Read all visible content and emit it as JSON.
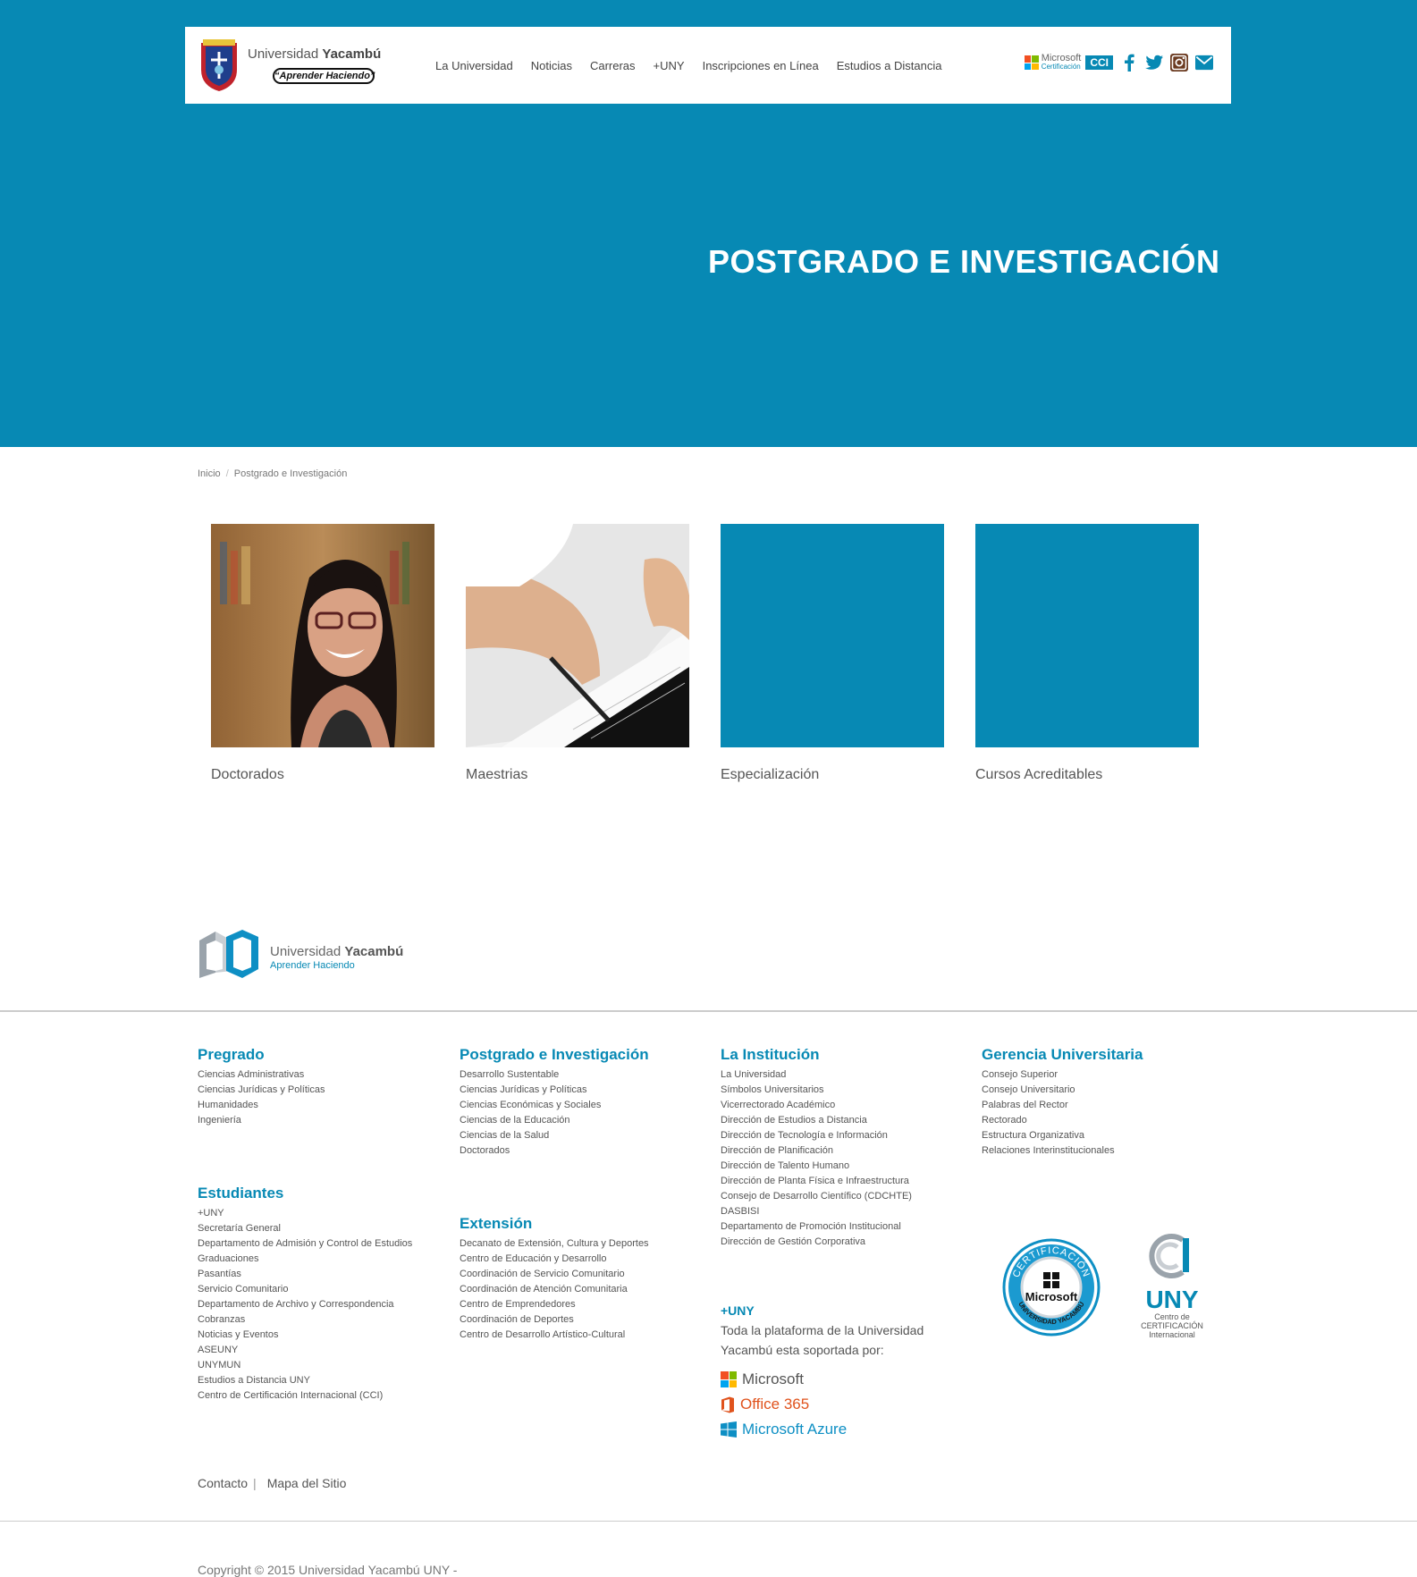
{
  "header": {
    "logo_name_regular": "Universidad",
    "logo_name_bold": "Yacambú",
    "logo_motto": "“Aprender Haciendo”",
    "nav": [
      "La Universidad",
      "Noticias",
      "Carreras",
      "+UNY",
      "Inscripciones en Línea",
      "Estudios a Distancia"
    ],
    "ms_badge_title": "Microsoft",
    "ms_badge_sub": "Certificación",
    "cci_label": "CCI"
  },
  "hero": {
    "title": "POSTGRADO E INVESTIGACIÓN",
    "bg_color": "#0789b4"
  },
  "breadcrumb": {
    "home": "Inicio",
    "current": "Postgrado e Investigación"
  },
  "cards": [
    {
      "label": "Doctorados",
      "image": "photo-woman-glasses"
    },
    {
      "label": "Maestrias",
      "image": "photo-hand-writing"
    },
    {
      "label": "Especialización",
      "image": "blue-placeholder"
    },
    {
      "label": "Cursos Acreditables",
      "image": "blue-placeholder"
    }
  ],
  "footer_logo": {
    "name_regular": "Universidad",
    "name_bold": "Yacambú",
    "motto": "Aprender Haciendo"
  },
  "footer_columns": {
    "pregrado": {
      "title": "Pregrado",
      "items": [
        "Ciencias Administrativas",
        "Ciencias Jurídicas y Políticas",
        "Humanidades",
        "Ingeniería"
      ]
    },
    "estudiantes": {
      "title": "Estudiantes",
      "items": [
        "+UNY",
        "Secretaría General",
        "Departamento de Admisión y Control de Estudios",
        "Graduaciones",
        "Pasantías",
        "Servicio Comunitario",
        "Departamento de Archivo y Correspondencia",
        "Cobranzas",
        "Noticias y Eventos",
        "ASEUNY",
        "UNYMUN",
        "Estudios a Distancia UNY",
        "Centro de Certificación Internacional (CCI)"
      ]
    },
    "postgrado": {
      "title": "Postgrado e Investigación",
      "items": [
        "Desarrollo Sustentable",
        "Ciencias Jurídicas y Políticas",
        "Ciencias Económicas y Sociales",
        "Ciencias de la Educación",
        "Ciencias de la Salud",
        "Doctorados"
      ]
    },
    "extension": {
      "title": "Extensión",
      "items": [
        "Decanato de Extensión, Cultura y Deportes",
        "Centro de Educación y Desarrollo",
        "Coordinación de Servicio Comunitario",
        "Coordinación de Atención Comunitaria",
        "Centro de Emprendedores",
        "Coordinación de Deportes",
        "Centro de Desarrollo Artístico-Cultural"
      ]
    },
    "institucion": {
      "title": "La Institución",
      "items": [
        "La Universidad",
        "Símbolos Universitarios",
        "Vicerrectorado Académico",
        "Dirección de Estudios a Distancia",
        "Dirección de Tecnología e Información",
        "Dirección de Planificación",
        "Dirección de Talento Humano",
        "Dirección de Planta Física e Infraestructura",
        "Consejo de Desarrollo Científico (CDCHTE)",
        "DASBISI",
        "Departamento de Promoción Institucional",
        "Dirección de Gestión Corporativa"
      ]
    },
    "gerencia": {
      "title": "Gerencia Universitaria",
      "items": [
        "Consejo Superior",
        "Consejo Universitario",
        "Palabras del Rector",
        "Rectorado",
        "Estructura Organizativa",
        "Relaciones Interinstitucionales"
      ]
    }
  },
  "platform": {
    "heading": "+UNY",
    "text": "Toda la plataforma de la Universidad Yacambú esta soportada por:",
    "brands": [
      "Microsoft",
      "Office 365",
      "Microsoft Azure"
    ]
  },
  "cert_badge": {
    "ring_top": "CERTIFICACIÓN",
    "center": "Microsoft",
    "ring_bottom": "UNIVERSIDAD YACAMBÚ"
  },
  "uny_cci": {
    "big": "UNY",
    "line1": "Centro de",
    "line2": "CERTIFICACIÓN",
    "line3": "Internacional"
  },
  "bottom_links": [
    "Contacto",
    "Mapa del Sitio"
  ],
  "copyright": "Copyright © 2015 Universidad Yacambú UNY -"
}
